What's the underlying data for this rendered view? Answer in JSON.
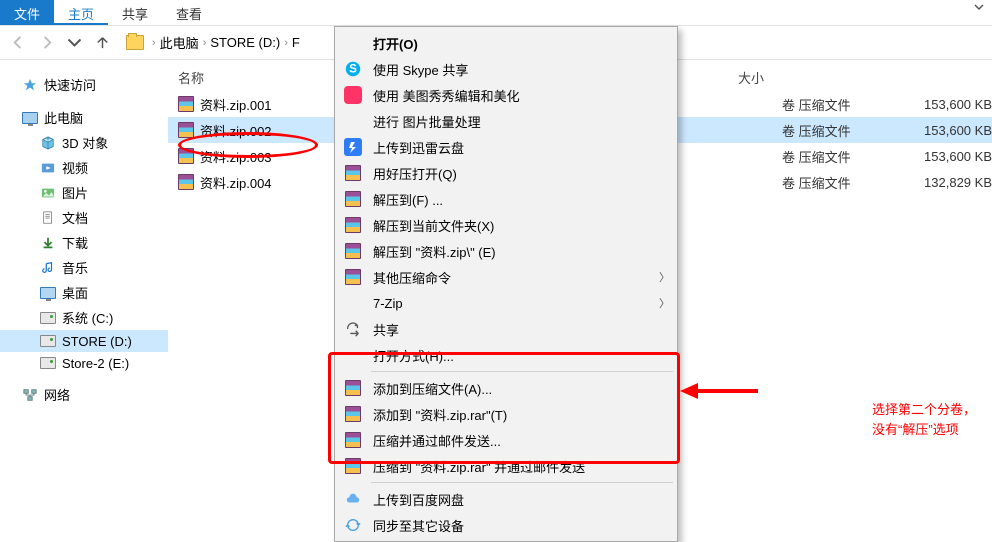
{
  "ribbon": {
    "file": "文件",
    "home": "主页",
    "share": "共享",
    "view": "查看"
  },
  "breadcrumb": {
    "pc": "此电脑",
    "drive": "STORE (D:)",
    "folder_prefix": "F"
  },
  "sidebar": {
    "quick": "快速访问",
    "pc": "此电脑",
    "obj3d": "3D 对象",
    "video": "视频",
    "pictures": "图片",
    "documents": "文档",
    "downloads": "下载",
    "music": "音乐",
    "desktop": "桌面",
    "sys": "系统 (C:)",
    "store": "STORE (D:)",
    "store2": "Store-2 (E:)",
    "network": "网络"
  },
  "columns": {
    "name": "名称",
    "size": "大小"
  },
  "files": [
    {
      "name": "资料.zip.001",
      "type": "卷 压缩文件",
      "size": "153,600 KB"
    },
    {
      "name": "资料.zip.002",
      "type": "卷 压缩文件",
      "size": "153,600 KB"
    },
    {
      "name": "资料.zip.003",
      "type": "卷 压缩文件",
      "size": "153,600 KB"
    },
    {
      "name": "资料.zip.004",
      "type": "卷 压缩文件",
      "size": "132,829 KB"
    }
  ],
  "menu": {
    "open": "打开(O)",
    "skype": "使用 Skype 共享",
    "meitu": "使用 美图秀秀编辑和美化",
    "batch": "进行 图片批量处理",
    "xunlei": "上传到迅雷云盘",
    "haozip": "用好压打开(Q)",
    "extract_to": "解压到(F) ...",
    "extract_here": "解压到当前文件夹(X)",
    "extract_named": "解压到 \"资料.zip\\\" (E)",
    "other_zip": "其他压缩命令",
    "sevenzip": "7-Zip",
    "share": "共享",
    "open_with": "打开方式(H)...",
    "add_archive": "添加到压缩文件(A)...",
    "add_rar": "添加到 \"资料.zip.rar\"(T)",
    "compress_email": "压缩并通过邮件发送...",
    "compress_rar_email": "压缩到 \"资料.zip.rar\" 并通过邮件发送",
    "baidu": "上传到百度网盘",
    "sync": "同步至其它设备"
  },
  "callout": {
    "line1": "选择第二个分卷，",
    "line2": "没有“解压”选项"
  }
}
